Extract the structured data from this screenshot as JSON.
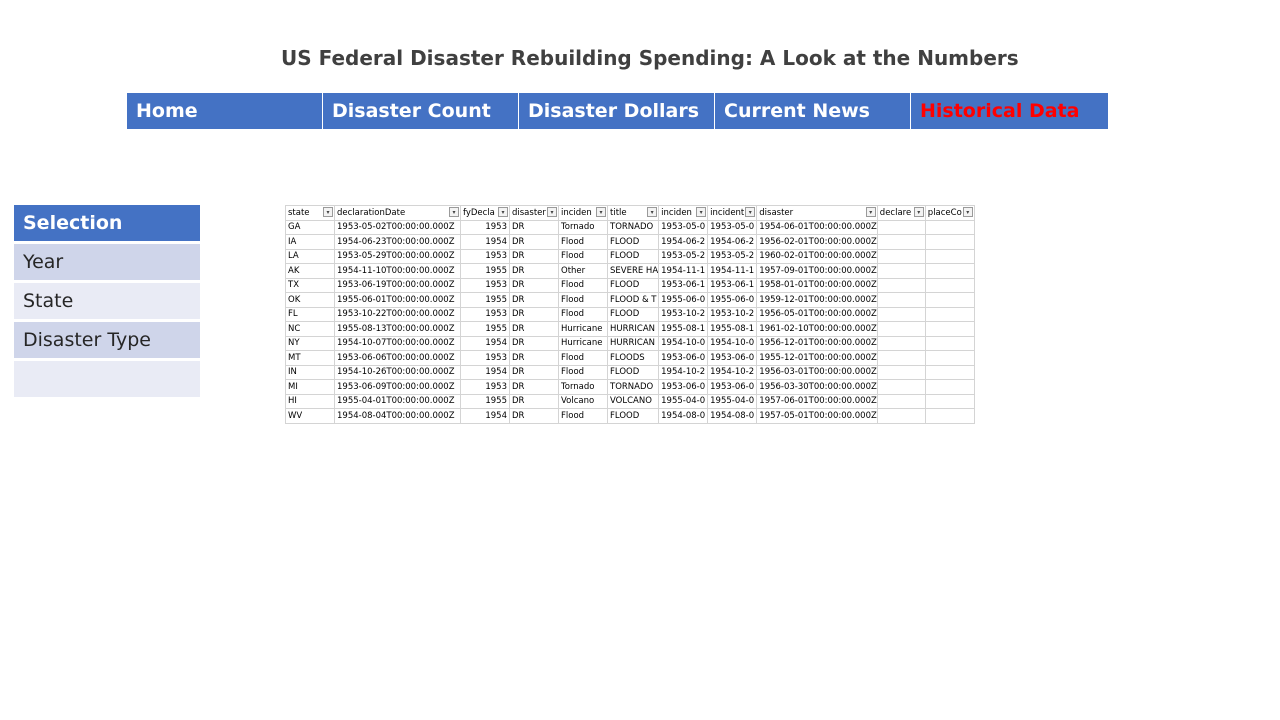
{
  "title": "US Federal Disaster Rebuilding Spending: A Look at the Numbers",
  "nav": [
    {
      "label": "Home"
    },
    {
      "label": "Disaster Count"
    },
    {
      "label": "Disaster Dollars"
    },
    {
      "label": "Current News"
    },
    {
      "label": "Historical Data"
    }
  ],
  "selection": {
    "header": "Selection",
    "items": [
      "Year",
      "State",
      "Disaster Type",
      ""
    ]
  },
  "table": {
    "filter_icon": "▾",
    "columns": [
      "state",
      "declarationDate",
      "fyDecla",
      "disaster",
      "inciden",
      "title",
      "inciden",
      "incident",
      "disaster",
      "declare",
      "placeCo"
    ],
    "rows": [
      [
        "GA",
        "1953-05-02T00:00:00.000Z",
        "1953",
        "DR",
        "Tornado",
        "TORNADO",
        "1953-05-0",
        "1953-05-0",
        "1954-06-01T00:00:00.000Z",
        "",
        ""
      ],
      [
        "IA",
        "1954-06-23T00:00:00.000Z",
        "1954",
        "DR",
        "Flood",
        "FLOOD",
        "1954-06-2",
        "1954-06-2",
        "1956-02-01T00:00:00.000Z",
        "",
        ""
      ],
      [
        "LA",
        "1953-05-29T00:00:00.000Z",
        "1953",
        "DR",
        "Flood",
        "FLOOD",
        "1953-05-2",
        "1953-05-2",
        "1960-02-01T00:00:00.000Z",
        "",
        ""
      ],
      [
        "AK",
        "1954-11-10T00:00:00.000Z",
        "1955",
        "DR",
        "Other",
        "SEVERE HA",
        "1954-11-1",
        "1954-11-1",
        "1957-09-01T00:00:00.000Z",
        "",
        ""
      ],
      [
        "TX",
        "1953-06-19T00:00:00.000Z",
        "1953",
        "DR",
        "Flood",
        "FLOOD",
        "1953-06-1",
        "1953-06-1",
        "1958-01-01T00:00:00.000Z",
        "",
        ""
      ],
      [
        "OK",
        "1955-06-01T00:00:00.000Z",
        "1955",
        "DR",
        "Flood",
        "FLOOD & T",
        "1955-06-0",
        "1955-06-0",
        "1959-12-01T00:00:00.000Z",
        "",
        ""
      ],
      [
        "FL",
        "1953-10-22T00:00:00.000Z",
        "1953",
        "DR",
        "Flood",
        "FLOOD",
        "1953-10-2",
        "1953-10-2",
        "1956-05-01T00:00:00.000Z",
        "",
        ""
      ],
      [
        "NC",
        "1955-08-13T00:00:00.000Z",
        "1955",
        "DR",
        "Hurricane",
        "HURRICAN",
        "1955-08-1",
        "1955-08-1",
        "1961-02-10T00:00:00.000Z",
        "",
        ""
      ],
      [
        "NY",
        "1954-10-07T00:00:00.000Z",
        "1954",
        "DR",
        "Hurricane",
        "HURRICAN",
        "1954-10-0",
        "1954-10-0",
        "1956-12-01T00:00:00.000Z",
        "",
        ""
      ],
      [
        "MT",
        "1953-06-06T00:00:00.000Z",
        "1953",
        "DR",
        "Flood",
        "FLOODS",
        "1953-06-0",
        "1953-06-0",
        "1955-12-01T00:00:00.000Z",
        "",
        ""
      ],
      [
        "IN",
        "1954-10-26T00:00:00.000Z",
        "1954",
        "DR",
        "Flood",
        "FLOOD",
        "1954-10-2",
        "1954-10-2",
        "1956-03-01T00:00:00.000Z",
        "",
        ""
      ],
      [
        "MI",
        "1953-06-09T00:00:00.000Z",
        "1953",
        "DR",
        "Tornado",
        "TORNADO",
        "1953-06-0",
        "1953-06-0",
        "1956-03-30T00:00:00.000Z",
        "",
        ""
      ],
      [
        "HI",
        "1955-04-01T00:00:00.000Z",
        "1955",
        "DR",
        "Volcano",
        "VOLCANO",
        "1955-04-0",
        "1955-04-0",
        "1957-06-01T00:00:00.000Z",
        "",
        ""
      ],
      [
        "WV",
        "1954-08-04T00:00:00.000Z",
        "1954",
        "DR",
        "Flood",
        "FLOOD",
        "1954-08-0",
        "1954-08-0",
        "1957-05-01T00:00:00.000Z",
        "",
        ""
      ]
    ]
  }
}
